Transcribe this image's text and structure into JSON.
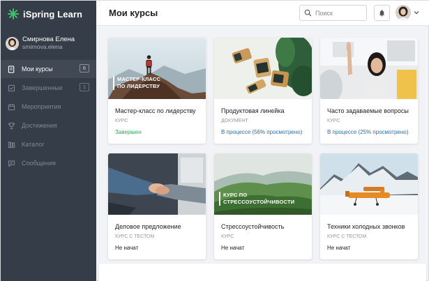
{
  "app": {
    "name": "iSpring Learn"
  },
  "user": {
    "name": "Смирнова Елена",
    "login": "smirnova.elena"
  },
  "sidebar": {
    "items": [
      {
        "label": "Мои курсы",
        "badge": "6",
        "icon": "book-icon",
        "active": true
      },
      {
        "label": "Завершенные",
        "badge": "1",
        "icon": "checklist-icon",
        "active": false
      },
      {
        "label": "Мероприятия",
        "icon": "calendar-icon",
        "active": false
      },
      {
        "label": "Достижения",
        "icon": "trophy-icon",
        "active": false
      },
      {
        "label": "Каталог",
        "icon": "library-icon",
        "active": false
      },
      {
        "label": "Сообщения",
        "icon": "message-icon",
        "active": false
      }
    ]
  },
  "header": {
    "title": "Мои курсы",
    "search_placeholder": "Поиск",
    "icons": [
      "search-icon",
      "bell-icon",
      "chevron-down-icon"
    ]
  },
  "courses": [
    {
      "title": "Мастер-класс по лидерству",
      "type": "Курс",
      "status": "Завершен",
      "overlay": "Мастер-класс по лидерству"
    },
    {
      "title": "Продуктовая линейка",
      "type": "Документ",
      "status": "В процессе (56% просмотрено)"
    },
    {
      "title": "Часто задаваемые вопросы",
      "type": "Курс",
      "status": "В процессе (25% просмотрено)"
    },
    {
      "title": "Деловое предложение",
      "type": "Курс с тестом",
      "status": "Не начат"
    },
    {
      "title": "Стрессоустойчивость",
      "type": "Курс",
      "status": "Не начат",
      "overlay": "Курс по стрессоустойчивости"
    },
    {
      "title": "Техники холодных звонков",
      "type": "Курс с тестом",
      "status": "Не начат"
    }
  ],
  "colors": {
    "sidebar": "#353d48",
    "accent_green": "#2bac57",
    "accent_blue": "#2a6fb5"
  }
}
